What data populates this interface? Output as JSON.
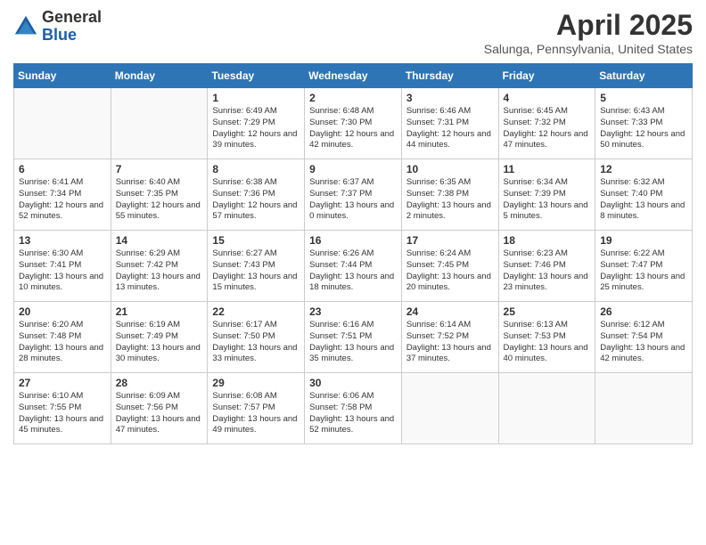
{
  "logo": {
    "general": "General",
    "blue": "Blue"
  },
  "header": {
    "month_year": "April 2025",
    "location": "Salunga, Pennsylvania, United States"
  },
  "weekdays": [
    "Sunday",
    "Monday",
    "Tuesday",
    "Wednesday",
    "Thursday",
    "Friday",
    "Saturday"
  ],
  "weeks": [
    [
      {
        "day": "",
        "empty": true
      },
      {
        "day": "",
        "empty": true
      },
      {
        "day": "1",
        "sunrise": "Sunrise: 6:49 AM",
        "sunset": "Sunset: 7:29 PM",
        "daylight": "Daylight: 12 hours and 39 minutes."
      },
      {
        "day": "2",
        "sunrise": "Sunrise: 6:48 AM",
        "sunset": "Sunset: 7:30 PM",
        "daylight": "Daylight: 12 hours and 42 minutes."
      },
      {
        "day": "3",
        "sunrise": "Sunrise: 6:46 AM",
        "sunset": "Sunset: 7:31 PM",
        "daylight": "Daylight: 12 hours and 44 minutes."
      },
      {
        "day": "4",
        "sunrise": "Sunrise: 6:45 AM",
        "sunset": "Sunset: 7:32 PM",
        "daylight": "Daylight: 12 hours and 47 minutes."
      },
      {
        "day": "5",
        "sunrise": "Sunrise: 6:43 AM",
        "sunset": "Sunset: 7:33 PM",
        "daylight": "Daylight: 12 hours and 50 minutes."
      }
    ],
    [
      {
        "day": "6",
        "sunrise": "Sunrise: 6:41 AM",
        "sunset": "Sunset: 7:34 PM",
        "daylight": "Daylight: 12 hours and 52 minutes."
      },
      {
        "day": "7",
        "sunrise": "Sunrise: 6:40 AM",
        "sunset": "Sunset: 7:35 PM",
        "daylight": "Daylight: 12 hours and 55 minutes."
      },
      {
        "day": "8",
        "sunrise": "Sunrise: 6:38 AM",
        "sunset": "Sunset: 7:36 PM",
        "daylight": "Daylight: 12 hours and 57 minutes."
      },
      {
        "day": "9",
        "sunrise": "Sunrise: 6:37 AM",
        "sunset": "Sunset: 7:37 PM",
        "daylight": "Daylight: 13 hours and 0 minutes."
      },
      {
        "day": "10",
        "sunrise": "Sunrise: 6:35 AM",
        "sunset": "Sunset: 7:38 PM",
        "daylight": "Daylight: 13 hours and 2 minutes."
      },
      {
        "day": "11",
        "sunrise": "Sunrise: 6:34 AM",
        "sunset": "Sunset: 7:39 PM",
        "daylight": "Daylight: 13 hours and 5 minutes."
      },
      {
        "day": "12",
        "sunrise": "Sunrise: 6:32 AM",
        "sunset": "Sunset: 7:40 PM",
        "daylight": "Daylight: 13 hours and 8 minutes."
      }
    ],
    [
      {
        "day": "13",
        "sunrise": "Sunrise: 6:30 AM",
        "sunset": "Sunset: 7:41 PM",
        "daylight": "Daylight: 13 hours and 10 minutes."
      },
      {
        "day": "14",
        "sunrise": "Sunrise: 6:29 AM",
        "sunset": "Sunset: 7:42 PM",
        "daylight": "Daylight: 13 hours and 13 minutes."
      },
      {
        "day": "15",
        "sunrise": "Sunrise: 6:27 AM",
        "sunset": "Sunset: 7:43 PM",
        "daylight": "Daylight: 13 hours and 15 minutes."
      },
      {
        "day": "16",
        "sunrise": "Sunrise: 6:26 AM",
        "sunset": "Sunset: 7:44 PM",
        "daylight": "Daylight: 13 hours and 18 minutes."
      },
      {
        "day": "17",
        "sunrise": "Sunrise: 6:24 AM",
        "sunset": "Sunset: 7:45 PM",
        "daylight": "Daylight: 13 hours and 20 minutes."
      },
      {
        "day": "18",
        "sunrise": "Sunrise: 6:23 AM",
        "sunset": "Sunset: 7:46 PM",
        "daylight": "Daylight: 13 hours and 23 minutes."
      },
      {
        "day": "19",
        "sunrise": "Sunrise: 6:22 AM",
        "sunset": "Sunset: 7:47 PM",
        "daylight": "Daylight: 13 hours and 25 minutes."
      }
    ],
    [
      {
        "day": "20",
        "sunrise": "Sunrise: 6:20 AM",
        "sunset": "Sunset: 7:48 PM",
        "daylight": "Daylight: 13 hours and 28 minutes."
      },
      {
        "day": "21",
        "sunrise": "Sunrise: 6:19 AM",
        "sunset": "Sunset: 7:49 PM",
        "daylight": "Daylight: 13 hours and 30 minutes."
      },
      {
        "day": "22",
        "sunrise": "Sunrise: 6:17 AM",
        "sunset": "Sunset: 7:50 PM",
        "daylight": "Daylight: 13 hours and 33 minutes."
      },
      {
        "day": "23",
        "sunrise": "Sunrise: 6:16 AM",
        "sunset": "Sunset: 7:51 PM",
        "daylight": "Daylight: 13 hours and 35 minutes."
      },
      {
        "day": "24",
        "sunrise": "Sunrise: 6:14 AM",
        "sunset": "Sunset: 7:52 PM",
        "daylight": "Daylight: 13 hours and 37 minutes."
      },
      {
        "day": "25",
        "sunrise": "Sunrise: 6:13 AM",
        "sunset": "Sunset: 7:53 PM",
        "daylight": "Daylight: 13 hours and 40 minutes."
      },
      {
        "day": "26",
        "sunrise": "Sunrise: 6:12 AM",
        "sunset": "Sunset: 7:54 PM",
        "daylight": "Daylight: 13 hours and 42 minutes."
      }
    ],
    [
      {
        "day": "27",
        "sunrise": "Sunrise: 6:10 AM",
        "sunset": "Sunset: 7:55 PM",
        "daylight": "Daylight: 13 hours and 45 minutes."
      },
      {
        "day": "28",
        "sunrise": "Sunrise: 6:09 AM",
        "sunset": "Sunset: 7:56 PM",
        "daylight": "Daylight: 13 hours and 47 minutes."
      },
      {
        "day": "29",
        "sunrise": "Sunrise: 6:08 AM",
        "sunset": "Sunset: 7:57 PM",
        "daylight": "Daylight: 13 hours and 49 minutes."
      },
      {
        "day": "30",
        "sunrise": "Sunrise: 6:06 AM",
        "sunset": "Sunset: 7:58 PM",
        "daylight": "Daylight: 13 hours and 52 minutes."
      },
      {
        "day": "",
        "empty": true
      },
      {
        "day": "",
        "empty": true
      },
      {
        "day": "",
        "empty": true
      }
    ]
  ]
}
